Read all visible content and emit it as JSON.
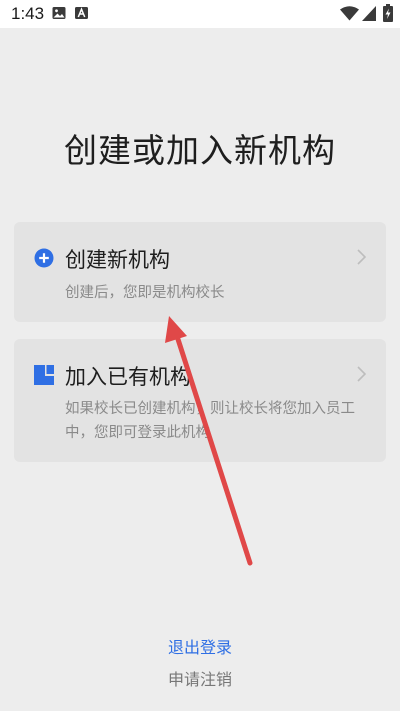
{
  "status_bar": {
    "time": "1:43",
    "left_icons": [
      "image-icon",
      "font-a-icon"
    ],
    "right_icons": [
      "wifi-icon",
      "signal-icon",
      "battery-charging-icon"
    ]
  },
  "page": {
    "title": "创建或加入新机构"
  },
  "cards": [
    {
      "title": "创建新机构",
      "description": "创建后，您即是机构校长",
      "icon": "plus-circle-icon"
    },
    {
      "title": "加入已有机构",
      "description": "如果校长已创建机构，则让校长将您加入员工中，您即可登录此机构",
      "icon": "building-icon"
    }
  ],
  "footer": {
    "logout": "退出登录",
    "cancel_account": "申请注销"
  },
  "colors": {
    "accent": "#2f6fe4",
    "annotation_arrow": "#e04848",
    "background": "#ededed",
    "card": "#e3e3e3"
  }
}
